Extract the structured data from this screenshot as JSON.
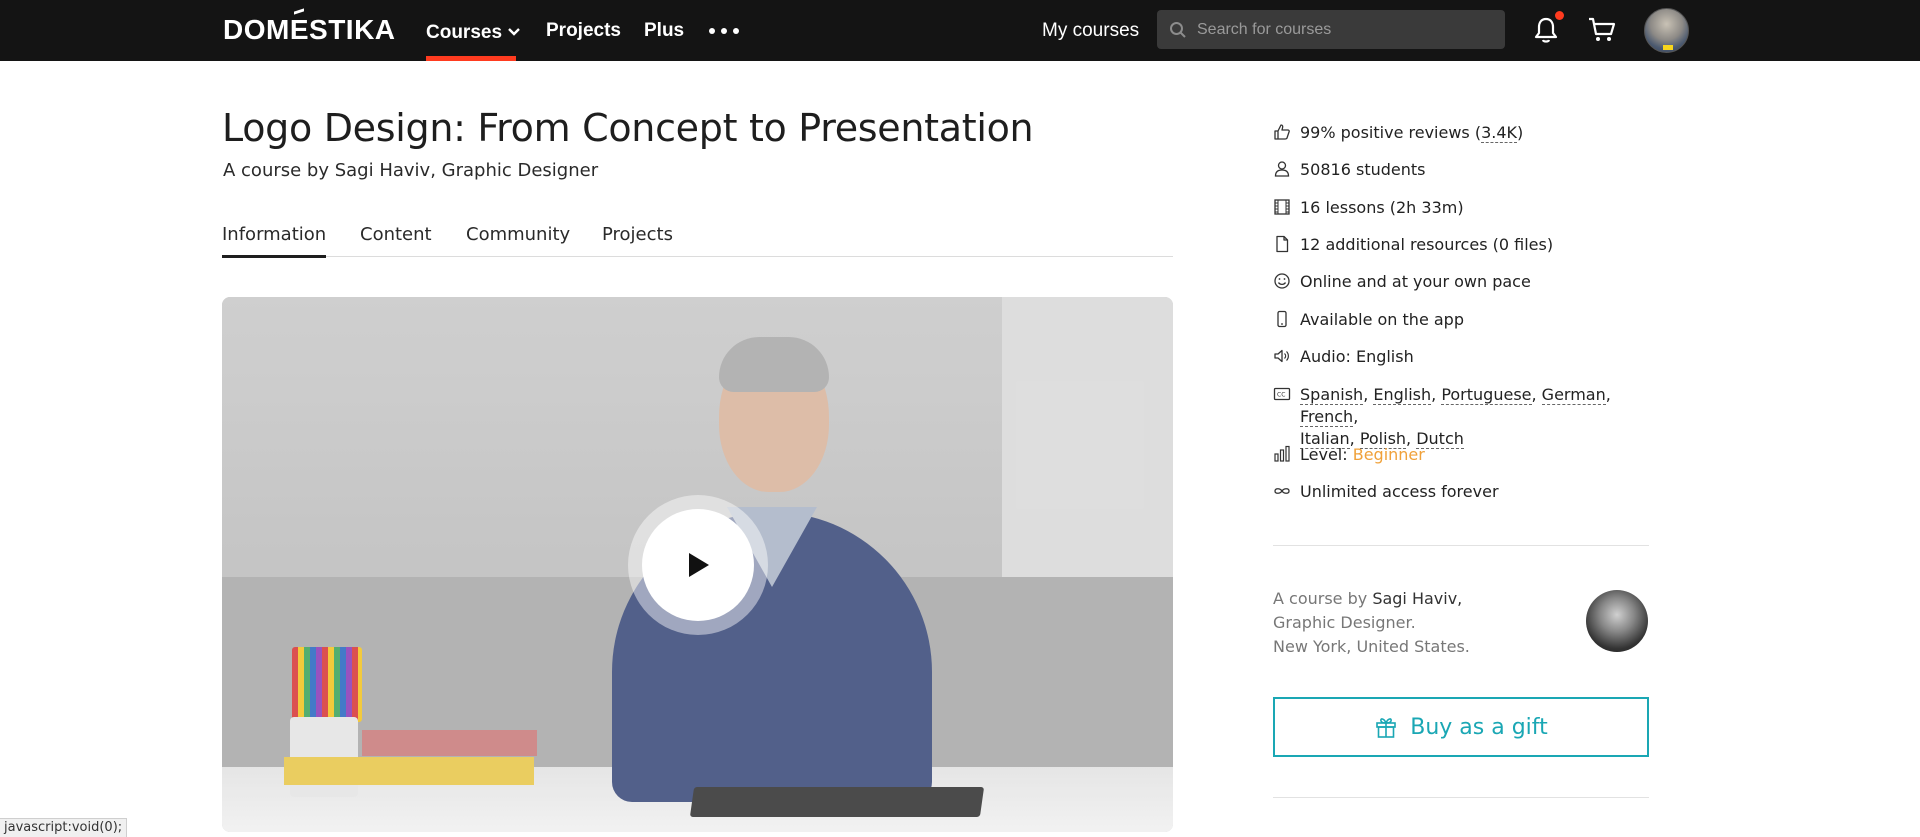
{
  "nav": {
    "logo": "DOMESTIKA",
    "courses": "Courses",
    "projects": "Projects",
    "plus": "Plus",
    "my_courses": "My courses",
    "search_placeholder": "Search for courses",
    "accent_color": "#ff3b1f"
  },
  "course": {
    "title": "Logo Design: From Concept to Presentation",
    "byline": "A course by Sagi Haviv, Graphic Designer",
    "tabs": [
      "Information",
      "Content",
      "Community",
      "Projects"
    ],
    "active_tab": "Information"
  },
  "facts": {
    "reviews_prefix": "99% positive reviews (",
    "reviews_count": "3.4K",
    "reviews_suffix": ")",
    "students": "50816 students",
    "lessons": "16 lessons (2h 33m)",
    "resources": "12 additional resources (0 files)",
    "pace": "Online and at your own pace",
    "app": "Available on the app",
    "audio": "Audio: English",
    "subtitles": [
      "Spanish",
      "English",
      "Portuguese",
      "German",
      "French",
      "Italian",
      "Polish",
      "Dutch"
    ],
    "level_label": "Level: ",
    "level_value": "Beginner",
    "access": "Unlimited access forever"
  },
  "author": {
    "prefix": "A course by ",
    "name": "Sagi Haviv,",
    "role": "Graphic Designer.",
    "location": "New York, United States."
  },
  "gift_button": "Buy as a gift",
  "status_bar": "javascript:void(0);"
}
